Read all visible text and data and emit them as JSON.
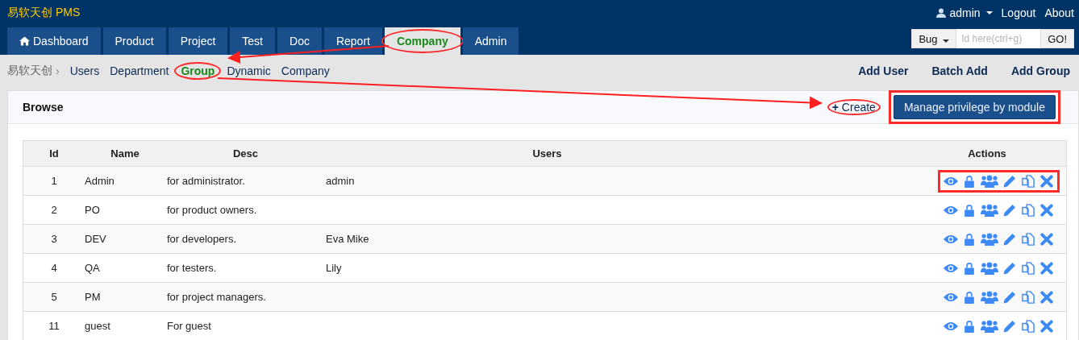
{
  "app_title": "易软天创 PMS",
  "user_menu": {
    "user": "admin",
    "links": [
      "Logout",
      "About"
    ]
  },
  "tabs": [
    {
      "label": "Dashboard",
      "kind": "home",
      "selected": false,
      "circled": false
    },
    {
      "label": "Product",
      "selected": false,
      "circled": false
    },
    {
      "label": "Project",
      "selected": false,
      "circled": false
    },
    {
      "label": "Test",
      "selected": false,
      "circled": false
    },
    {
      "label": "Doc",
      "selected": false,
      "circled": false
    },
    {
      "label": "Report",
      "selected": false,
      "circled": false
    },
    {
      "label": "Company",
      "selected": true,
      "circled": true
    },
    {
      "label": "Admin",
      "selected": false,
      "circled": false
    }
  ],
  "quick_search": {
    "type": "Bug",
    "placeholder": "Id here(ctrl+g)",
    "button": "GO!"
  },
  "breadcrumb": {
    "root": "易软天创",
    "sep": "›",
    "items": [
      {
        "label": "Users",
        "selected": false,
        "circled": false
      },
      {
        "label": "Department",
        "selected": false,
        "circled": false
      },
      {
        "label": "Group",
        "selected": true,
        "circled": true
      },
      {
        "label": "Dynamic",
        "selected": false,
        "circled": false
      },
      {
        "label": "Company",
        "selected": false,
        "circled": false
      }
    ]
  },
  "actions": [
    "Add User",
    "Batch Add",
    "Add Group"
  ],
  "panel": {
    "title": "Browse",
    "create": {
      "icon": "+",
      "label": "Create",
      "circled": true
    },
    "manage": {
      "label": "Manage privilege by module",
      "boxed": true
    }
  },
  "table": {
    "columns": [
      "Id",
      "Name",
      "Desc",
      "Users",
      "Actions"
    ],
    "rows": [
      {
        "id": "1",
        "name": "Admin",
        "desc": "for administrator.",
        "users": "admin",
        "boxed": true
      },
      {
        "id": "2",
        "name": "PO",
        "desc": "for product owners.",
        "boxed": false
      },
      {
        "id": "3",
        "name": "DEV",
        "desc": "for developers.",
        "users": "Eva Mike",
        "boxed": false
      },
      {
        "id": "4",
        "name": "QA",
        "desc": "for testers.",
        "users": "Lily",
        "boxed": false
      },
      {
        "id": "5",
        "name": "PM",
        "desc": "for project managers.",
        "boxed": false
      },
      {
        "id": "11",
        "name": "guest",
        "desc": "For guest",
        "boxed": false
      }
    ]
  },
  "annotation_arrows": {
    "tab_to_breadcrumb": true,
    "breadcrumb_to_create": true
  }
}
